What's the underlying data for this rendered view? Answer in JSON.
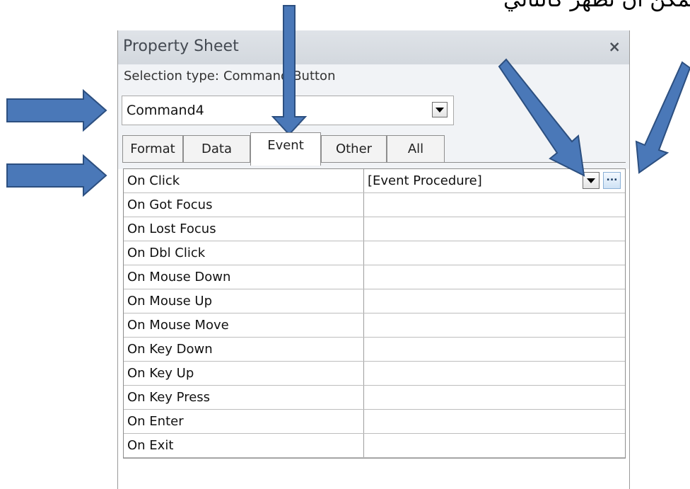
{
  "caption": "ويمكن أن تظهر كالتالي",
  "panel": {
    "title": "Property Sheet",
    "close_glyph": "×",
    "selection_label": "Selection type:",
    "selection_value": "Command Button",
    "object_combo_value": "Command4"
  },
  "tabs": [
    {
      "label": "Format",
      "active": false
    },
    {
      "label": "Data",
      "active": false
    },
    {
      "label": "Event",
      "active": true
    },
    {
      "label": "Other",
      "active": false
    },
    {
      "label": "All",
      "active": false
    }
  ],
  "properties": [
    {
      "name": "On Click",
      "value": "[Event Procedure]"
    },
    {
      "name": "On Got Focus",
      "value": ""
    },
    {
      "name": "On Lost Focus",
      "value": ""
    },
    {
      "name": "On Dbl Click",
      "value": ""
    },
    {
      "name": "On Mouse Down",
      "value": ""
    },
    {
      "name": "On Mouse Up",
      "value": ""
    },
    {
      "name": "On Mouse Move",
      "value": ""
    },
    {
      "name": "On Key Down",
      "value": ""
    },
    {
      "name": "On Key Up",
      "value": ""
    },
    {
      "name": "On Key Press",
      "value": ""
    },
    {
      "name": "On Enter",
      "value": ""
    },
    {
      "name": "On Exit",
      "value": ""
    }
  ],
  "builder_glyph": "...",
  "icons": {
    "close": "close-icon",
    "dropdown": "chevron-down-icon",
    "builder": "ellipsis-icon",
    "annotation": "arrow-icon"
  },
  "colors": {
    "arrow_fill": "#4a78b8",
    "arrow_stroke": "#2c4f80",
    "titlebar": "#d8dde3"
  }
}
